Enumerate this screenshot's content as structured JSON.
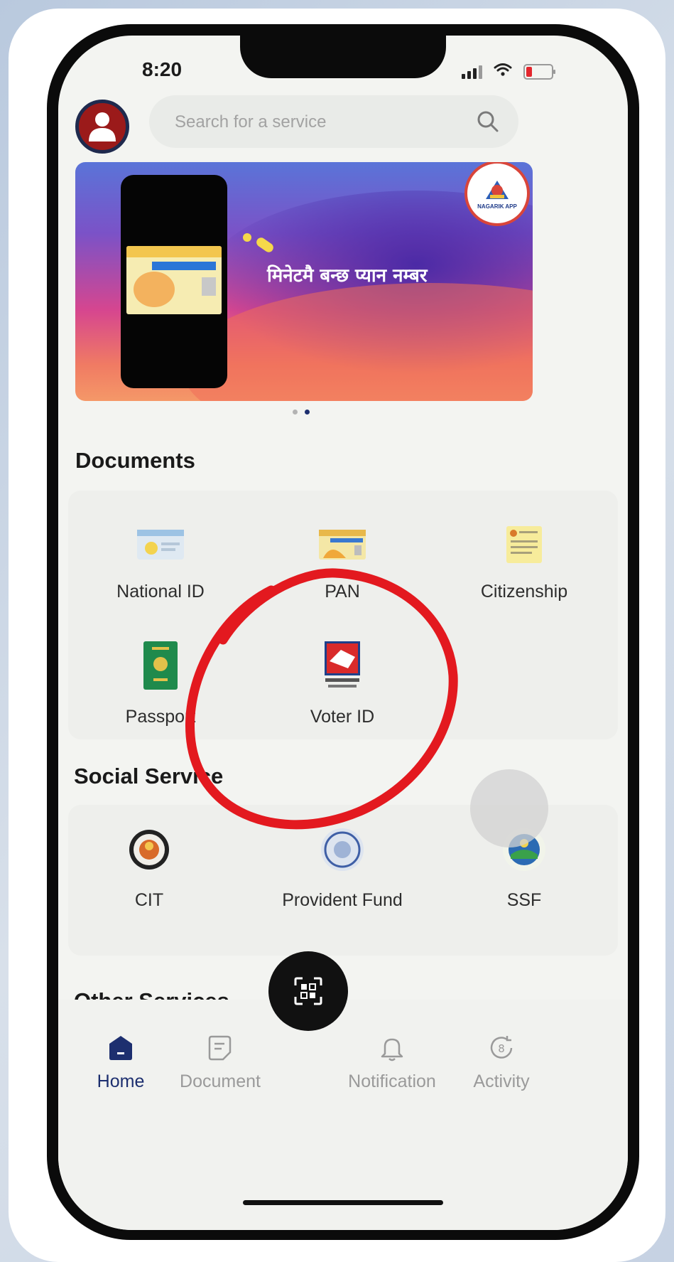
{
  "status_bar": {
    "time": "8:20"
  },
  "search": {
    "placeholder": "Search for a service"
  },
  "banner": {
    "text": "मिनेटमै बन्छ प्यान नम्बर",
    "logo_text": "NAGARIK APP",
    "slide_count": 2,
    "active_slide": 2
  },
  "documents": {
    "title": "Documents",
    "items": [
      {
        "label": "National ID"
      },
      {
        "label": "PAN"
      },
      {
        "label": "Citizenship"
      },
      {
        "label": "Passport"
      },
      {
        "label": "Voter ID"
      }
    ]
  },
  "social": {
    "title": "Social Service",
    "items": [
      {
        "label": "CIT"
      },
      {
        "label": "Provident Fund"
      },
      {
        "label": "SSF"
      }
    ]
  },
  "other": {
    "title": "Other Services"
  },
  "tabs": [
    {
      "label": "Home",
      "icon": "home-icon",
      "active": true
    },
    {
      "label": "Document",
      "icon": "document-icon",
      "active": false
    },
    {
      "label": "Notification",
      "icon": "bell-icon",
      "active": false
    },
    {
      "label": "Activity",
      "icon": "activity-icon",
      "active": false
    }
  ],
  "colors": {
    "accent": "#1d2f6f",
    "annotation": "#e3191f",
    "avatar": "#9b1a1a"
  }
}
